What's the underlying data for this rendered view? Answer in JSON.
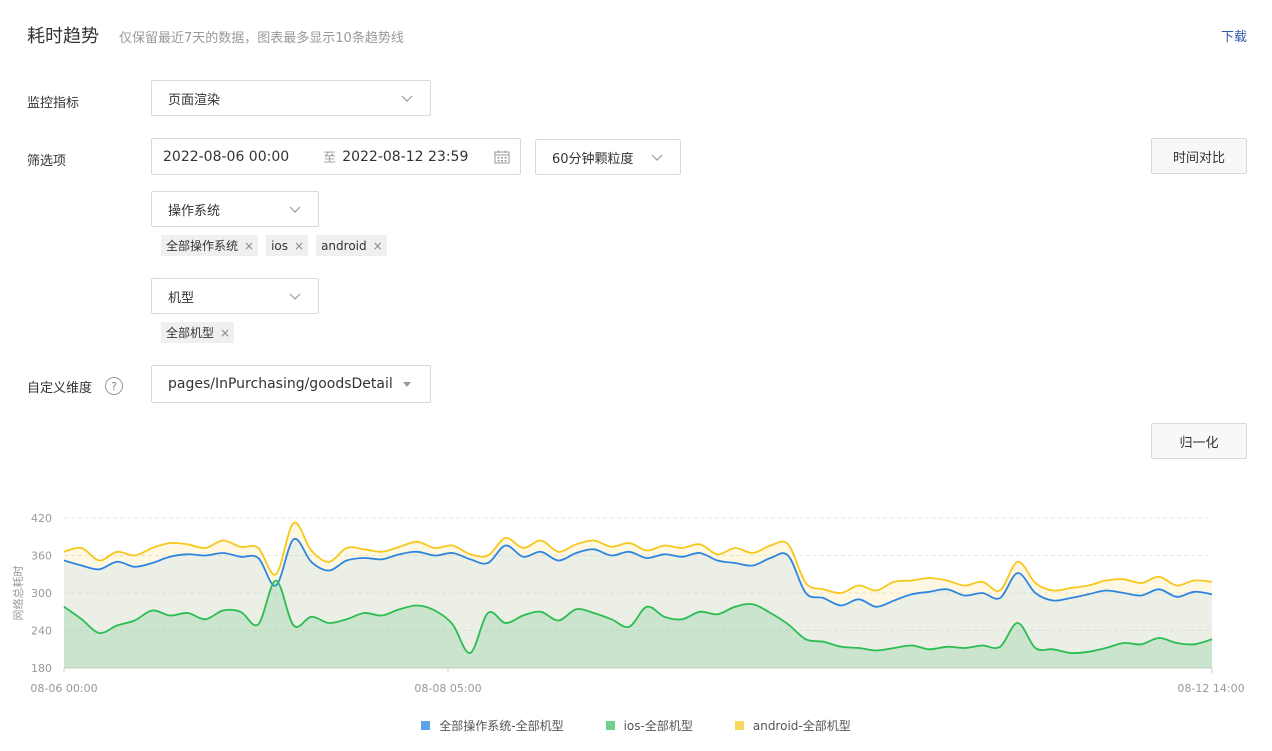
{
  "header": {
    "title": "耗时趋势",
    "subtitle": "仅保留最近7天的数据，图表最多显示10条趋势线",
    "download": "下载"
  },
  "filters": {
    "metric_label": "监控指标",
    "metric_value": "页面渲染",
    "filter_label": "筛选项",
    "date_start": "2022-08-06 00:00",
    "date_sep": "至",
    "date_end": "2022-08-12 23:59",
    "granularity": "60分钟颗粒度",
    "compare_button": "时间对比",
    "os_select": "操作系统",
    "os_tags": [
      "全部操作系统",
      "ios",
      "android"
    ],
    "model_select": "机型",
    "model_tags": [
      "全部机型"
    ],
    "custom_label": "自定义维度",
    "custom_help": "?",
    "custom_value": "pages/InPurchasing/goodsDetail",
    "normalize_button": "归一化"
  },
  "chart_data": {
    "type": "line",
    "ylabel": "网络总耗时",
    "ylim": [
      180,
      420
    ],
    "y_ticks": [
      "180",
      "240",
      "300",
      "360",
      "420"
    ],
    "x_ticks": [
      "08-06 00:00",
      "08-08 05:00",
      "08-12 14:00"
    ],
    "series": [
      {
        "name": "全部操作系统-全部机型",
        "color": "#2f86e0",
        "values": [
          352,
          344,
          338,
          350,
          342,
          348,
          358,
          362,
          360,
          364,
          358,
          356,
          312,
          386,
          350,
          336,
          352,
          356,
          354,
          362,
          366,
          360,
          364,
          354,
          348,
          376,
          358,
          366,
          352,
          364,
          370,
          360,
          366,
          356,
          362,
          358,
          364,
          352,
          348,
          344,
          356,
          360,
          300,
          292,
          280,
          290,
          278,
          288,
          298,
          302,
          306,
          296,
          300,
          292,
          332,
          300,
          288,
          292,
          298,
          304,
          300,
          296,
          306,
          294,
          302,
          298
        ],
        "x_ratio": 1.0
      },
      {
        "name": "ios-全部机型",
        "color": "#2bbd52",
        "values": [
          278,
          258,
          236,
          248,
          256,
          272,
          264,
          268,
          258,
          272,
          270,
          250,
          320,
          248,
          262,
          252,
          258,
          268,
          264,
          274,
          280,
          272,
          250,
          204,
          268,
          252,
          264,
          270,
          256,
          274,
          268,
          258,
          246,
          278,
          262,
          258,
          270,
          266,
          278,
          282,
          268,
          250,
          226,
          222,
          214,
          212,
          208,
          212,
          216,
          210,
          214,
          212,
          216,
          214,
          252,
          212,
          210,
          204,
          206,
          212,
          220,
          218,
          228,
          220,
          218,
          226
        ],
        "x_ratio": 1.0
      },
      {
        "name": "android-全部机型",
        "color": "#f7c71c",
        "values": [
          366,
          372,
          352,
          366,
          360,
          372,
          380,
          378,
          372,
          384,
          374,
          372,
          330,
          412,
          368,
          350,
          372,
          370,
          366,
          374,
          382,
          372,
          376,
          362,
          360,
          388,
          372,
          384,
          366,
          378,
          384,
          374,
          380,
          368,
          376,
          372,
          378,
          362,
          372,
          364,
          376,
          378,
          316,
          306,
          300,
          312,
          304,
          318,
          320,
          324,
          320,
          312,
          318,
          304,
          350,
          316,
          304,
          308,
          312,
          320,
          322,
          316,
          326,
          312,
          320,
          318
        ],
        "x_ratio": 1.0
      }
    ],
    "grid": true,
    "legend_position": "bottom"
  }
}
